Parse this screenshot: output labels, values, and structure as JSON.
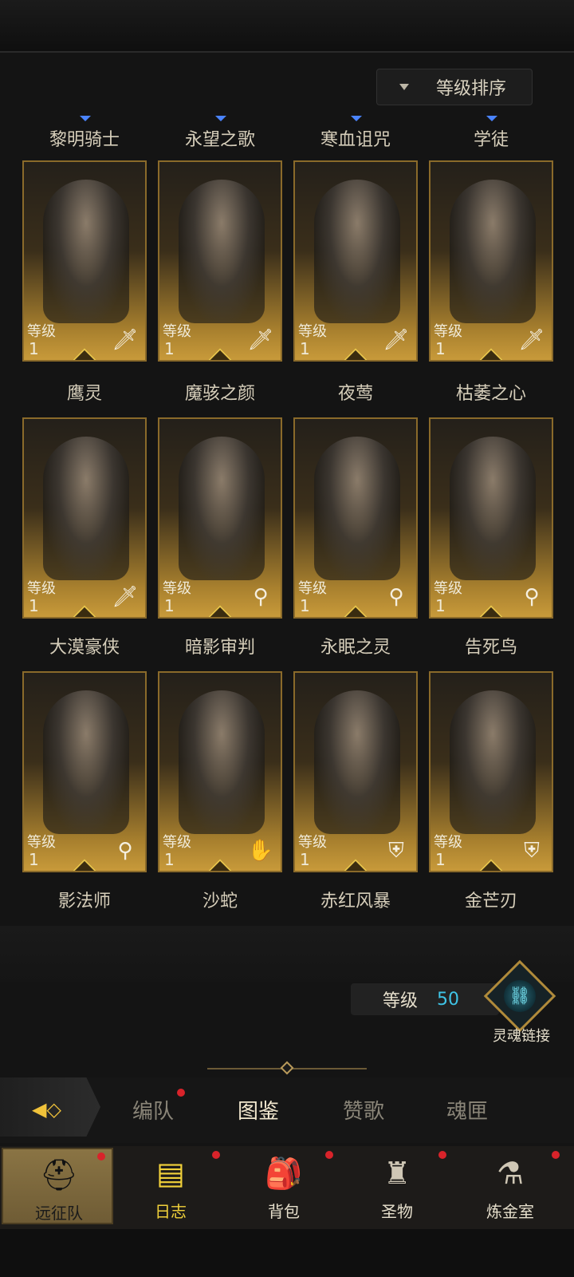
{
  "sort": {
    "label": "等级排序"
  },
  "level_label": "等级",
  "cards": [
    {
      "name": "黎明骑士",
      "level": "1",
      "class_icon": "sword-icon"
    },
    {
      "name": "永望之歌",
      "level": "1",
      "class_icon": "sword-icon"
    },
    {
      "name": "寒血诅咒",
      "level": "1",
      "class_icon": "sword-icon"
    },
    {
      "name": "学徒",
      "level": "1",
      "class_icon": "sword-icon"
    },
    {
      "name": "鹰灵",
      "level": "1",
      "class_icon": "sword-icon"
    },
    {
      "name": "魔骇之颜",
      "level": "1",
      "class_icon": "staff-icon"
    },
    {
      "name": "夜莺",
      "level": "1",
      "class_icon": "staff-icon"
    },
    {
      "name": "枯萎之心",
      "level": "1",
      "class_icon": "staff-icon"
    },
    {
      "name": "大漠豪侠",
      "level": "1",
      "class_icon": "staff-icon"
    },
    {
      "name": "暗影审判",
      "level": "1",
      "class_icon": "hand-icon"
    },
    {
      "name": "永眠之灵",
      "level": "1",
      "class_icon": "shield-icon"
    },
    {
      "name": "告死鸟",
      "level": "1",
      "class_icon": "shield-icon"
    }
  ],
  "bottom_names": [
    "影法师",
    "沙蛇",
    "赤红风暴",
    "金芒刃"
  ],
  "level_panel": {
    "label": "等级",
    "value": "50"
  },
  "soul_link": {
    "label": "灵魂链接"
  },
  "tabs": [
    {
      "label": "编队",
      "active": false,
      "dot": true
    },
    {
      "label": "图鉴",
      "active": true,
      "dot": false
    },
    {
      "label": "赞歌",
      "active": false,
      "dot": false
    },
    {
      "label": "魂匣",
      "active": false,
      "dot": false
    }
  ],
  "nav": [
    {
      "label": "远征队",
      "icon": "viking-helmet-icon",
      "active": true,
      "dot": true
    },
    {
      "label": "日志",
      "icon": "journal-icon",
      "active": false,
      "dot": true
    },
    {
      "label": "背包",
      "icon": "backpack-icon",
      "active": false,
      "dot": true
    },
    {
      "label": "圣物",
      "icon": "relic-icon",
      "active": false,
      "dot": true
    },
    {
      "label": "炼金室",
      "icon": "alchemy-icon",
      "active": false,
      "dot": true
    }
  ]
}
